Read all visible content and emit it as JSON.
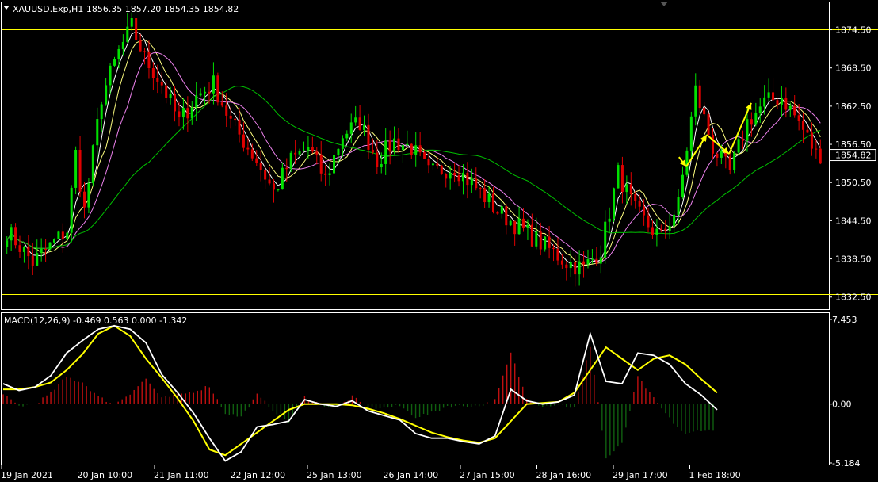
{
  "colors": {
    "background": "#000000",
    "frame": "#ffffff",
    "bull": "#00e000",
    "bear": "#e00000",
    "level_line": "#ffff00",
    "ma_fast": "#ffffff",
    "ma_mid": "#ffff80",
    "ma_slow": "#ee82ee",
    "ma_long": "#00c000",
    "macd_line": "#ffffff",
    "signal_line": "#ffff00",
    "forecast": "#ffff00"
  },
  "chart_data": [
    {
      "type": "candlestick",
      "title": "XAUUSD.Exp,H1  1856.35 1857.20 1854.35 1854.82",
      "ylim": [
        1830.6,
        1878.8
      ],
      "yticks": [
        "1874.50",
        "1868.50",
        "1862.50",
        "1856.50",
        "1850.50",
        "1844.50",
        "1838.50",
        "1832.50"
      ],
      "current_price": "1854.82",
      "horizontal_levels": [
        1874.5,
        1832.9
      ],
      "xticks": [
        "19 Jan 2021",
        "20 Jan 10:00",
        "21 Jan 11:00",
        "22 Jan 12:00",
        "25 Jan 13:00",
        "26 Jan 14:00",
        "27 Jan 15:00",
        "28 Jan 16:00",
        "29 Jan 17:00",
        "1 Feb 18:00"
      ],
      "price_path": [
        [
          0,
          1843
        ],
        [
          6,
          1838
        ],
        [
          14,
          1843
        ],
        [
          16,
          1855
        ],
        [
          18,
          1846
        ],
        [
          22,
          1864
        ],
        [
          26,
          1871
        ],
        [
          29,
          1875
        ],
        [
          32,
          1870
        ],
        [
          36,
          1866
        ],
        [
          40,
          1860
        ],
        [
          44,
          1864
        ],
        [
          48,
          1866
        ],
        [
          52,
          1860
        ],
        [
          58,
          1854
        ],
        [
          62,
          1849
        ],
        [
          66,
          1854
        ],
        [
          70,
          1856
        ],
        [
          74,
          1851
        ],
        [
          78,
          1858
        ],
        [
          82,
          1860
        ],
        [
          86,
          1854
        ],
        [
          90,
          1857
        ],
        [
          94,
          1856
        ],
        [
          98,
          1852
        ],
        [
          104,
          1853
        ],
        [
          110,
          1849
        ],
        [
          114,
          1846
        ],
        [
          118,
          1844
        ],
        [
          122,
          1842
        ],
        [
          126,
          1840
        ],
        [
          130,
          1838
        ],
        [
          134,
          1837
        ],
        [
          138,
          1840
        ],
        [
          142,
          1852
        ],
        [
          146,
          1846
        ],
        [
          150,
          1843
        ],
        [
          152,
          1842
        ],
        [
          156,
          1847
        ],
        [
          160,
          1865
        ],
        [
          164,
          1856
        ],
        [
          168,
          1852
        ],
        [
          172,
          1860
        ],
        [
          176,
          1863
        ],
        [
          180,
          1864
        ],
        [
          184,
          1860
        ],
        [
          188,
          1855
        ]
      ],
      "forecast_path": [
        [
          1846.8,
          1854.5
        ],
        [
          1856,
          1853
        ],
        [
          1882,
          1858
        ],
        [
          1910,
          1855
        ],
        [
          1938,
          1863
        ]
      ]
    },
    {
      "type": "macd",
      "title": "MACD(12,26,9) -0.469 0.563 0.000 -1.342",
      "ylim": [
        -5.184,
        7.453
      ],
      "yticks": [
        "7.453",
        "0.00",
        "-5.184"
      ],
      "macd": [
        1.8,
        1.2,
        1.5,
        2.5,
        4.5,
        5.6,
        6.6,
        6.9,
        6.6,
        5.4,
        2.6,
        1.0,
        -0.8,
        -3.0,
        -5.0,
        -4.2,
        -2.0,
        -1.8,
        -1.5,
        0.4,
        0.0,
        -0.2,
        0.3,
        -0.6,
        -1.0,
        -1.4,
        -2.6,
        -3.0,
        -3.0,
        -3.3,
        -3.5,
        -2.8,
        1.3,
        0.3,
        0.0,
        0.2,
        0.8,
        6.2,
        2.0,
        1.8,
        4.5,
        4.3,
        3.5,
        1.8,
        0.8,
        -0.5
      ],
      "signal": [
        1.3,
        1.3,
        1.5,
        1.9,
        3.0,
        4.4,
        6.2,
        6.9,
        6.0,
        4.0,
        2.3,
        0.5,
        -1.5,
        -4.0,
        -4.5,
        -3.5,
        -2.5,
        -1.5,
        -0.5,
        0.0,
        0.0,
        0.0,
        -0.1,
        -0.4,
        -0.8,
        -1.3,
        -1.9,
        -2.5,
        -2.9,
        -3.2,
        -3.4,
        -3.0,
        -1.5,
        0.0,
        0.1,
        0.2,
        1.0,
        3.0,
        5.0,
        4.0,
        3.0,
        4.0,
        4.3,
        3.5,
        2.2,
        1.0
      ]
    }
  ]
}
